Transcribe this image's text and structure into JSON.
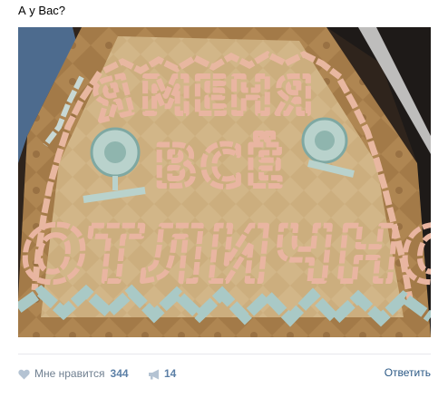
{
  "post": {
    "text": "А у Вас?",
    "photo_lettering": [
      "Я",
      "МЕНЯ",
      "ВСЁ",
      "ОТЛИЧНО"
    ]
  },
  "actions": {
    "like_label": "Мне нравится",
    "like_count": "344",
    "share_count": "14",
    "comment_label": "Ответить"
  },
  "colors": {
    "link": "#2a5885",
    "count": "#5b7fa6",
    "muted": "#6f7f90",
    "icon": "#b4c3d3"
  }
}
